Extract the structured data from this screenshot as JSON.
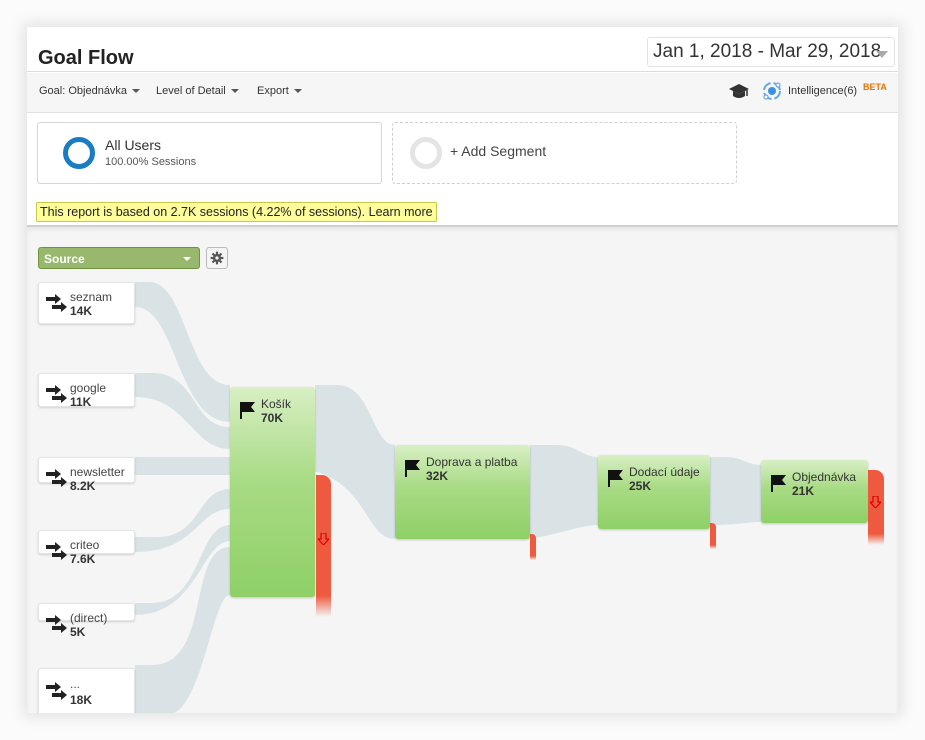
{
  "header": {
    "title": "Goal Flow",
    "date_range": "Jan 1, 2018 - Mar 29, 2018"
  },
  "toolbar": {
    "goal_label": "Goal: Objednávka",
    "level_label": "Level of Detail",
    "export_label": "Export",
    "intelligence_label": "Intelligence(6)",
    "beta_label": "BETA"
  },
  "segments": {
    "all_users": {
      "name": "All Users",
      "sub": "100.00% Sessions",
      "color": "#1a7cc2"
    },
    "add_label": "+ Add Segment"
  },
  "notice": {
    "text": "This report is based on 2.7K sessions (4.22% of sessions). ",
    "link": "Learn more"
  },
  "flow": {
    "dimension_label": "Source",
    "sources": [
      {
        "name": "seznam",
        "value": "14K"
      },
      {
        "name": "google",
        "value": "11K"
      },
      {
        "name": "newsletter",
        "value": "8.2K"
      },
      {
        "name": "criteo",
        "value": "7.6K"
      },
      {
        "name": "(direct)",
        "value": "5K"
      },
      {
        "name": "...",
        "value": "18K"
      }
    ],
    "steps": [
      {
        "name": "Košík",
        "value": "70K"
      },
      {
        "name": "Doprava a platba",
        "value": "32K"
      },
      {
        "name": "Dodací údaje",
        "value": "25K"
      },
      {
        "name": "Objednávka",
        "value": "21K"
      }
    ],
    "colors": {
      "flow": "#d9e3e5",
      "exit": "#ee5a3f",
      "node_green": "#9bd573"
    }
  }
}
